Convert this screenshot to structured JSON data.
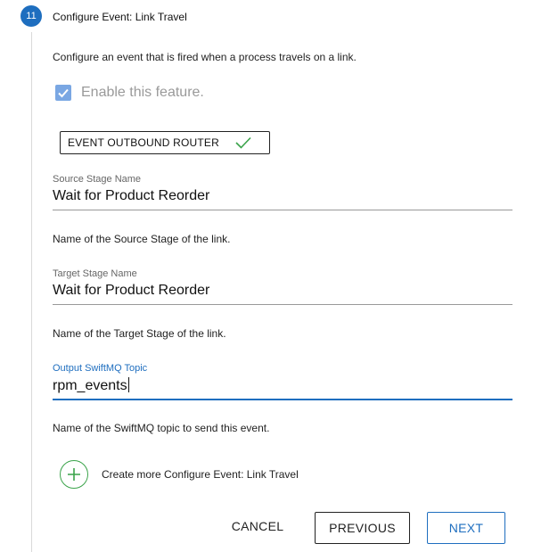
{
  "step": {
    "number": "11",
    "title": "Configure Event: Link Travel",
    "description": "Configure an event that is fired when a process travels on a link."
  },
  "enable": {
    "label": "Enable this feature.",
    "checked": true
  },
  "chip": {
    "label": "EVENT OUTBOUND ROUTER",
    "status_icon": "checkmark-icon"
  },
  "fields": [
    {
      "label": "Source Stage Name",
      "value": "Wait for Product Reorder",
      "help": "Name of the Source Stage of the link."
    },
    {
      "label": "Target Stage Name",
      "value": "Wait for Product Reorder",
      "help": "Name of the Target Stage of the link."
    },
    {
      "label": "Output SwiftMQ Topic",
      "value": "rpm_events",
      "help": "Name of the SwiftMQ topic to send this event."
    }
  ],
  "add_more": {
    "label": "Create more Configure Event: Link Travel",
    "icon": "plus-icon"
  },
  "buttons": {
    "cancel": "CANCEL",
    "previous": "PREVIOUS",
    "next": "NEXT"
  },
  "colors": {
    "accent": "#1e6ebf",
    "success": "#3aa34a",
    "checkbox": "#7aa7e3"
  }
}
